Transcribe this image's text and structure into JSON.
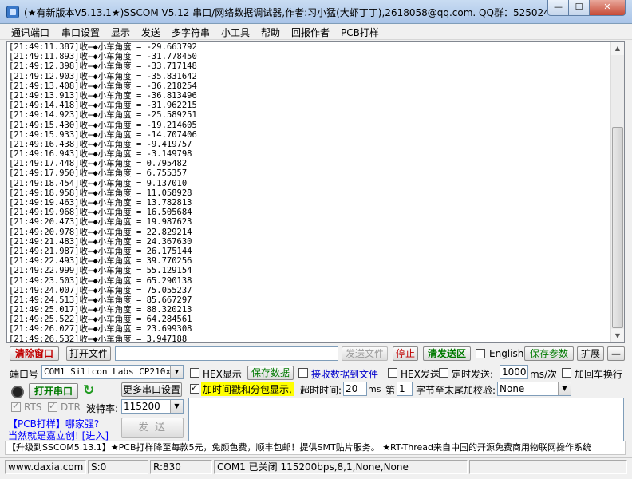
{
  "window": {
    "title": "(★有新版本V5.13.1★)SSCOM V5.12 串口/网络数据调试器,作者:习小猛(大虾丁丁),2618058@qq.com. QQ群：525024…",
    "min_glyph": "—",
    "max_glyph": "☐",
    "close_glyph": "✕"
  },
  "menu": [
    "通讯端口",
    "串口设置",
    "显示",
    "发送",
    "多字符串",
    "小工具",
    "帮助",
    "回报作者",
    "PCB打样"
  ],
  "log": {
    "lines": [
      "[21:49:11.387]收←◆小车角度 = -29.663792",
      "[21:49:11.893]收←◆小车角度 = -31.778450",
      "[21:49:12.398]收←◆小车角度 = -33.717148",
      "[21:49:12.903]收←◆小车角度 = -35.831642",
      "[21:49:13.408]收←◆小车角度 = -36.218254",
      "[21:49:13.913]收←◆小车角度 = -36.813496",
      "[21:49:14.418]收←◆小车角度 = -31.962215",
      "[21:49:14.923]收←◆小车角度 = -25.589251",
      "[21:49:15.430]收←◆小车角度 = -19.214605",
      "[21:49:15.933]收←◆小车角度 = -14.707406",
      "[21:49:16.438]收←◆小车角度 = -9.419757",
      "[21:49:16.943]收←◆小车角度 = -3.149798",
      "[21:49:17.448]收←◆小车角度 = 0.795482",
      "[21:49:17.950]收←◆小车角度 = 6.755357",
      "[21:49:18.454]收←◆小车角度 = 9.137010",
      "[21:49:18.958]收←◆小车角度 = 11.058928",
      "[21:49:19.463]收←◆小车角度 = 13.782813",
      "[21:49:19.968]收←◆小车角度 = 16.505684",
      "[21:49:20.473]收←◆小车角度 = 19.987623",
      "[21:49:20.978]收←◆小车角度 = 22.829214",
      "[21:49:21.483]收←◆小车角度 = 24.367630",
      "[21:49:21.987]收←◆小车角度 = 26.175144",
      "[21:49:22.493]收←◆小车角度 = 39.770256",
      "[21:49:22.999]收←◆小车角度 = 55.129154",
      "[21:49:23.503]收←◆小车角度 = 65.290138",
      "[21:49:24.007]收←◆小车角度 = 75.055237",
      "[21:49:24.513]收←◆小车角度 = 85.667297",
      "[21:49:25.017]收←◆小车角度 = 88.320213",
      "[21:49:25.522]收←◆小车角度 = 64.284561",
      "[21:49:26.027]收←◆小车角度 = 23.699308",
      "[21:49:26.532]收←◆小车角度 = 3.947188"
    ]
  },
  "toolbar": {
    "clear_window": "清除窗口",
    "open_file": "打开文件",
    "send_file": "发送文件",
    "stop": "停止",
    "clear_send": "清发送区",
    "english": "English",
    "save_params": "保存参数",
    "expand": "扩展",
    "collapse": "—"
  },
  "port": {
    "label": "端口号",
    "value": "COM1 Silicon Labs CP210x U",
    "open_button": "打开串口",
    "refresh_glyph": "↻",
    "more_settings": "更多串口设置",
    "rts": "RTS",
    "dtr": "DTR",
    "baud_label": "波特率:",
    "baud_value": "115200"
  },
  "options": {
    "hex_display": "HEX显示",
    "save_data": "保存数据",
    "recv_to_file": "接收数据到文件",
    "hex_send": "HEX发送",
    "timed_send": "定时发送:",
    "interval_value": "1000",
    "interval_unit": "ms/次",
    "add_crlf": "加回车换行",
    "timestamp": "加时间戳和分包显示,",
    "timeout_label": "超时时间:",
    "timeout_value": "20",
    "timeout_unit": "ms",
    "nth_label": "第",
    "nth_value": "1",
    "checksum_label": "字节至末尾加校验:",
    "checksum_value": "None"
  },
  "send": {
    "button": "发 送"
  },
  "promo": {
    "line1a": "【PCB打样】",
    "line1b": "哪家强?",
    "line2a": "当然就是嘉立创!",
    "line2b": "[进入]",
    "ticker": "【升级到SSCOM5.13.1】★PCB打样降至每款5元，免颜色费，顺丰包邮！提供SMT贴片服务。 ★RT-Thread来自中国的开源免费商用物联网操作系统"
  },
  "status": {
    "website": "www.daxia.com",
    "sent": "S:0",
    "received": "R:830",
    "port_state": "COM1 已关闭  115200bps,8,1,None,None"
  },
  "colors": {
    "accent_red": "#c00000",
    "accent_green": "#007a00",
    "highlight_yellow": "#ffff00",
    "link_blue": "#0000ff"
  }
}
